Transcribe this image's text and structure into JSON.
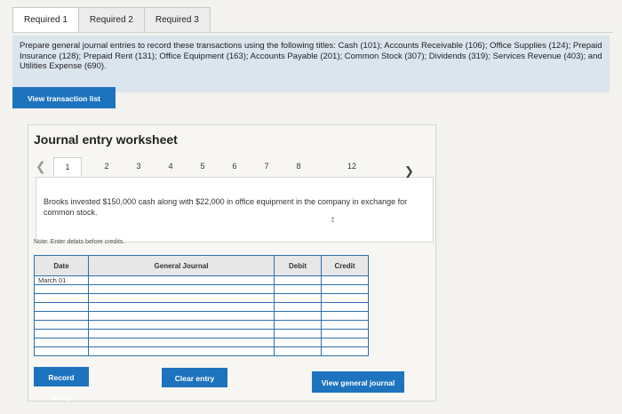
{
  "tabs": [
    {
      "label": "Required 1",
      "active": true
    },
    {
      "label": "Required 2",
      "active": false
    },
    {
      "label": "Required 3",
      "active": false
    }
  ],
  "instructions": "Prepare general journal entries to record these transactions using the following titles: Cash (101); Accounts Receivable (106); Office Supplies (124); Prepaid Insurance (128); Prepaid Rent (131); Office Equipment (163); Accounts Payable (201); Common Stock (307); Dividends (319); Services Revenue (403); and Utilities Expense (690).",
  "buttons": {
    "view_transaction_list": "View transaction list",
    "record_entry": "Record entry",
    "clear_entry": "Clear entry",
    "view_general_journal": "View general journal"
  },
  "worksheet": {
    "title": "Journal entry worksheet",
    "pages": [
      "1",
      "2",
      "3",
      "4",
      "5",
      "6",
      "7",
      "8",
      "12"
    ],
    "active_page": "1",
    "description": "Brooks invested $150,000 cash along with $22,000 in office equipment in the company in exchange for common stock.",
    "note": "Note: Enter debits before credits."
  },
  "journal_table": {
    "headers": {
      "date": "Date",
      "general_journal": "General Journal",
      "debit": "Debit",
      "credit": "Credit"
    },
    "rows": [
      {
        "date": "March 01",
        "account": "",
        "debit": "",
        "credit": ""
      },
      {
        "date": "",
        "account": "",
        "debit": "",
        "credit": ""
      },
      {
        "date": "",
        "account": "",
        "debit": "",
        "credit": ""
      },
      {
        "date": "",
        "account": "",
        "debit": "",
        "credit": ""
      },
      {
        "date": "",
        "account": "",
        "debit": "",
        "credit": ""
      },
      {
        "date": "",
        "account": "",
        "debit": "",
        "credit": ""
      },
      {
        "date": "",
        "account": "",
        "debit": "",
        "credit": ""
      },
      {
        "date": "",
        "account": "",
        "debit": "",
        "credit": ""
      },
      {
        "date": "",
        "account": "",
        "debit": "",
        "credit": ""
      }
    ]
  },
  "colors": {
    "button_blue": "#1e73be",
    "instructions_bg": "#dbe5ee",
    "table_border": "#2e6faf"
  }
}
